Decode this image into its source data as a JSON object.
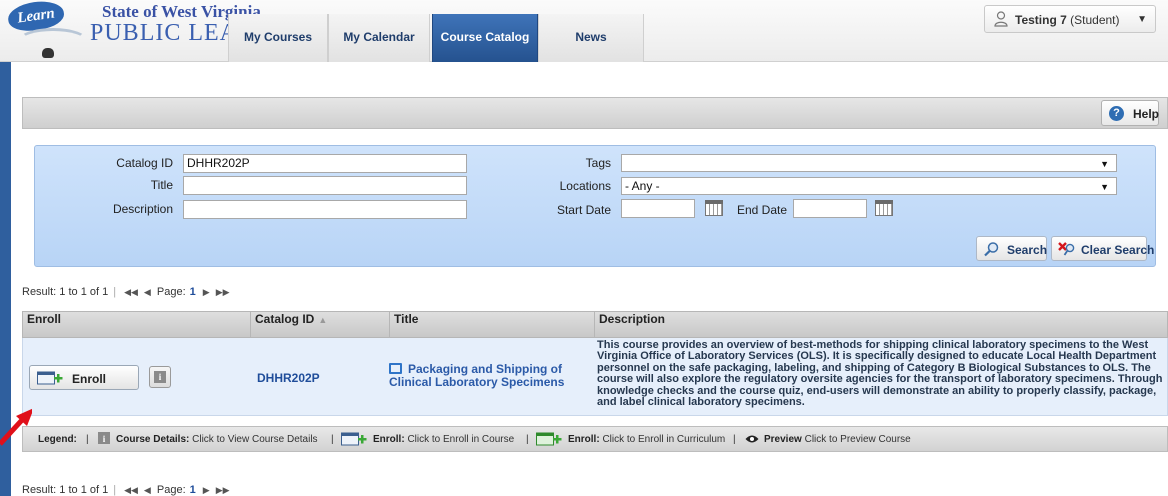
{
  "brand": {
    "logo_word": "Learn",
    "title_line1": "State of West Virginia",
    "title_line2": "PUBLIC LEARNING CENTER"
  },
  "nav": {
    "tabs": [
      {
        "label": "My Courses",
        "active": false
      },
      {
        "label": "My Calendar",
        "active": false
      },
      {
        "label": "Course Catalog",
        "active": true
      },
      {
        "label": "News",
        "active": false
      }
    ]
  },
  "user": {
    "name": "Testing 7",
    "role": "(Student)",
    "menu_caret": "▼"
  },
  "toolbar": {
    "help_label": "Help",
    "help_icon": "?"
  },
  "search": {
    "catalog_id": {
      "label": "Catalog ID",
      "value": "DHHR202P"
    },
    "title": {
      "label": "Title",
      "value": ""
    },
    "description": {
      "label": "Description",
      "value": ""
    },
    "tags": {
      "label": "Tags",
      "value": ""
    },
    "locations": {
      "label": "Locations",
      "value": "- Any -"
    },
    "start_date": {
      "label": "Start Date",
      "value": ""
    },
    "end_date": {
      "label": "End Date",
      "value": ""
    },
    "search_label": "Search",
    "clear_label": "Clear Search"
  },
  "pager": {
    "result_text": "Result: 1 to 1 of 1",
    "page_label": "Page:",
    "page_number": "1",
    "first_glyph": "◀◀",
    "prev_glyph": "◀",
    "next_glyph": "▶",
    "last_glyph": "▶▶"
  },
  "grid": {
    "columns": [
      {
        "label": "Enroll"
      },
      {
        "label": "Catalog ID",
        "sorted": "asc"
      },
      {
        "label": "Title"
      },
      {
        "label": "Description"
      }
    ],
    "sort_glyph": "▲",
    "rows": [
      {
        "enroll_label": "Enroll",
        "details_glyph": "i",
        "catalog_id": "DHHR202P",
        "title": "Packaging and Shipping of Clinical Laboratory Specimens",
        "description": "This course provides an overview of best-methods for shipping clinical laboratory specimens to the West Virginia Office of Laboratory Services (OLS). It is specifically designed to educate Local Health Department personnel on the safe packaging, labeling, and shipping of Category B Biological Substances to OLS. The course will also explore the regulatory oversite agencies for the transport of laboratory specimens. Through knowledge checks and the course quiz, end-users will demonstrate an ability to properly classify, package, and label clinical laboratory specimens."
      }
    ]
  },
  "legend": {
    "label": "Legend:",
    "items": [
      {
        "name": "Course Details:",
        "desc": "Click to View Course Details"
      },
      {
        "name": "Enroll:",
        "desc": "Click to Enroll in Course"
      },
      {
        "name": "Enroll:",
        "desc": "Click to Enroll in Curriculum"
      },
      {
        "name": "Preview",
        "desc": "Click to Preview Course"
      }
    ]
  },
  "colors": {
    "accent": "#2f5f9e",
    "active_tab": "#2f62a6",
    "panel": "#c4dbf8",
    "arrow": "#e0101a"
  },
  "icons": [
    "person-icon",
    "help-icon",
    "search-icon",
    "clear-search-icon",
    "calendar-icon",
    "enroll-course-icon",
    "course-details-icon",
    "book-icon",
    "enroll-curriculum-icon",
    "eye-icon"
  ]
}
